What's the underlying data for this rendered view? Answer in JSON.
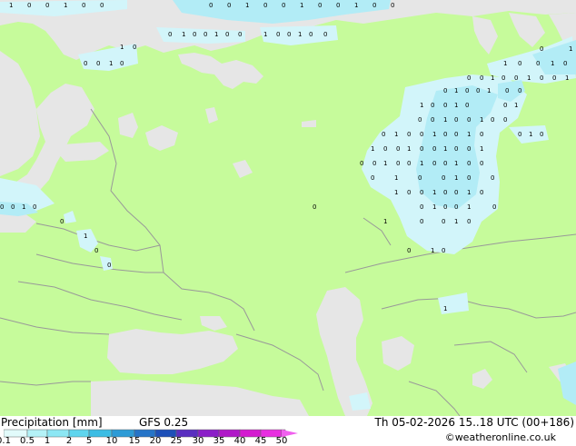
{
  "footer": {
    "title": "Precipitation [mm]",
    "model": "GFS 0.25",
    "validity": "Th 05-02-2026 15..18 UTC (00+186)",
    "credit": "©weatheronline.co.uk"
  },
  "legend": {
    "ticks": [
      "0.1",
      "0.5",
      "1",
      "2",
      "5",
      "10",
      "15",
      "20",
      "25",
      "30",
      "35",
      "40",
      "45",
      "50"
    ],
    "colors": [
      "#e2fbfb",
      "#b4f2f7",
      "#8ce7f4",
      "#5fd5ee",
      "#3cbde4",
      "#2d9bd6",
      "#2574c8",
      "#1d4fb8",
      "#5a2fc0",
      "#8b1fc8",
      "#b018c8",
      "#d41ad0",
      "#e82ee0",
      "#f060ee"
    ]
  },
  "map": {
    "colors": {
      "land": "#c6fb9b",
      "sea": "#e6e6e6",
      "border": "#999999",
      "precip_light": "#d2f5fa",
      "precip": "#b2ecf6",
      "precip_medium": "#8ddcf0"
    }
  }
}
